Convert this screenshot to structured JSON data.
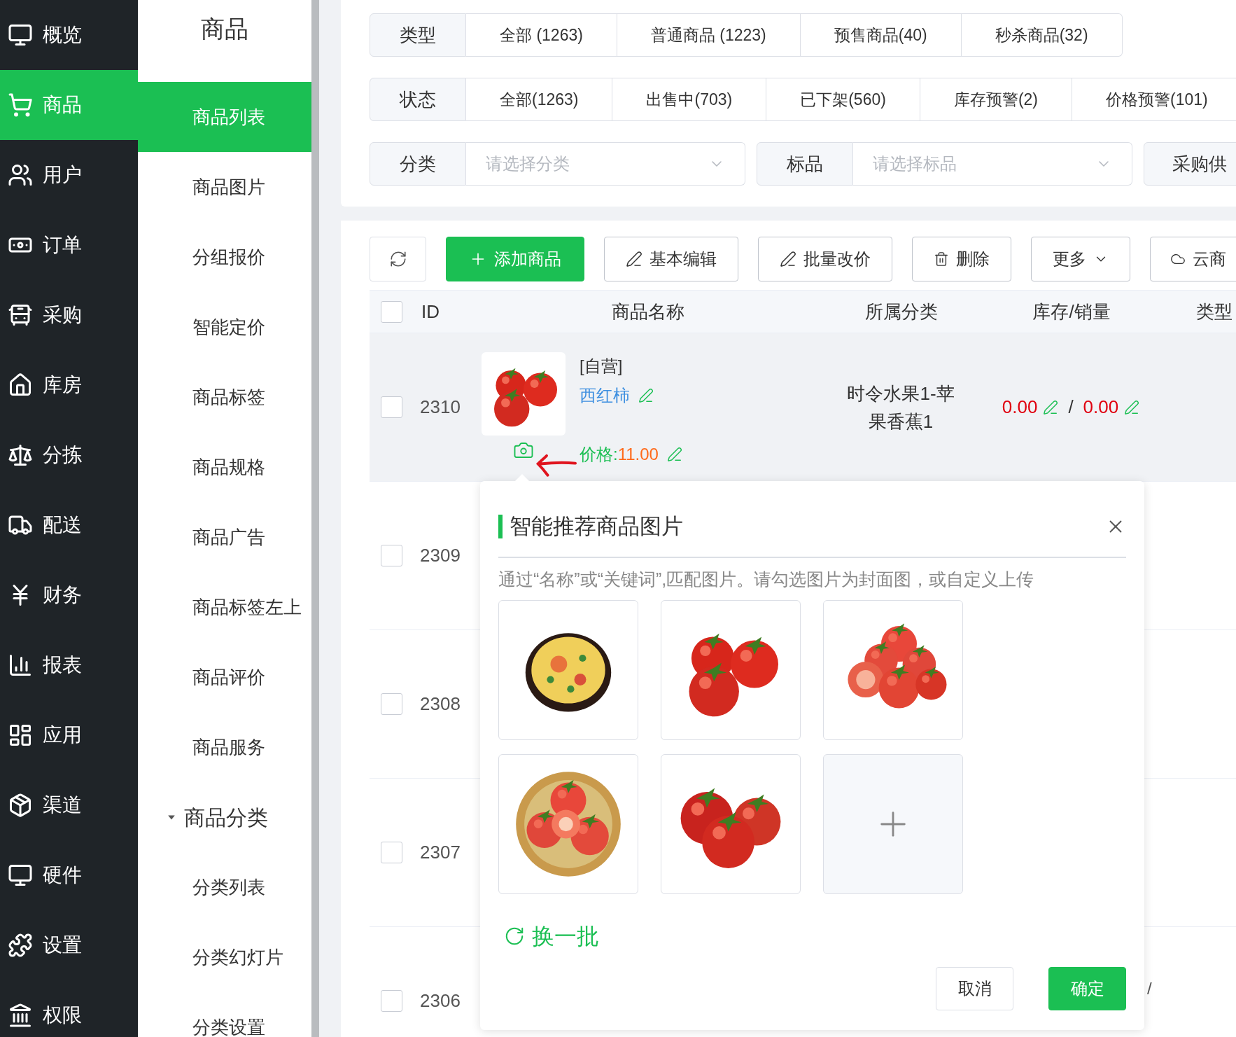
{
  "main_nav": {
    "items": [
      {
        "label": "概览",
        "selected": false
      },
      {
        "label": "商品",
        "selected": true
      },
      {
        "label": "用户",
        "selected": false
      },
      {
        "label": "订单",
        "selected": false
      },
      {
        "label": "采购",
        "selected": false
      },
      {
        "label": "库房",
        "selected": false
      },
      {
        "label": "分拣",
        "selected": false
      },
      {
        "label": "配送",
        "selected": false
      },
      {
        "label": "财务",
        "selected": false
      },
      {
        "label": "报表",
        "selected": false
      },
      {
        "label": "应用",
        "selected": false
      },
      {
        "label": "渠道",
        "selected": false
      },
      {
        "label": "硬件",
        "selected": false
      },
      {
        "label": "设置",
        "selected": false
      },
      {
        "label": "权限",
        "selected": false
      }
    ]
  },
  "sub_nav": {
    "title": "商品",
    "items": [
      {
        "kind": "link",
        "label": "商品列表",
        "selected": true
      },
      {
        "kind": "link",
        "label": "商品图片",
        "selected": false
      },
      {
        "kind": "link",
        "label": "分组报价",
        "selected": false
      },
      {
        "kind": "link",
        "label": "智能定价",
        "selected": false
      },
      {
        "kind": "link",
        "label": "商品标签",
        "selected": false
      },
      {
        "kind": "link",
        "label": "商品规格",
        "selected": false
      },
      {
        "kind": "link",
        "label": "商品广告",
        "selected": false
      },
      {
        "kind": "link",
        "label": "商品标签左上",
        "selected": false
      },
      {
        "kind": "link",
        "label": "商品评价",
        "selected": false
      },
      {
        "kind": "link",
        "label": "商品服务",
        "selected": false
      },
      {
        "kind": "group",
        "label": "商品分类",
        "expanded": true,
        "children": [
          {
            "label": "分类列表",
            "selected": false
          },
          {
            "label": "分类幻灯片",
            "selected": false
          },
          {
            "label": "分类设置",
            "selected": false
          }
        ]
      }
    ]
  },
  "filters": [
    {
      "label": "类型",
      "options": [
        "全部 (1263)",
        "普通商品 (1223)",
        "预售商品(40)",
        "秒杀商品(32)"
      ]
    },
    {
      "label": "状态",
      "options": [
        "全部(1263)",
        "出售中(703)",
        "已下架(560)",
        "库存预警(2)",
        "价格预警(101)"
      ]
    }
  ],
  "selects": [
    {
      "label": "分类",
      "placeholder": "请选择分类"
    },
    {
      "label": "标品",
      "placeholder": "请选择标品"
    },
    {
      "label": "采购供"
    }
  ],
  "toolbar": [
    {
      "kind": "refresh"
    },
    {
      "kind": "primary",
      "label": "添加商品"
    },
    {
      "kind": "edit",
      "label": "基本编辑"
    },
    {
      "kind": "edit",
      "label": "批量改价"
    },
    {
      "kind": "delete",
      "label": "删除"
    },
    {
      "kind": "dropdown",
      "label": "更多"
    },
    {
      "kind": "cloud",
      "label": "云商"
    }
  ],
  "table": {
    "columns": [
      "ID",
      "商品名称",
      "所属分类",
      "库存/销量",
      "类型"
    ],
    "header_checked": false,
    "rows": [
      {
        "id": "2310",
        "checked": false,
        "hovered": true,
        "tag": "[自营]",
        "name": "西红柿",
        "price_label": "价格:",
        "price": "11.00",
        "category": "时令水果1-苹果香蕉1",
        "stock": "0.00",
        "separator": "/",
        "sales": "0.00"
      },
      {
        "id": "2309",
        "checked": false,
        "hovered": false
      },
      {
        "id": "2308",
        "checked": false,
        "hovered": false
      },
      {
        "id": "2307",
        "checked": false,
        "hovered": false
      },
      {
        "id": "2306",
        "checked": false,
        "hovered": false,
        "column_5_fragment": "/"
      }
    ]
  },
  "popover": {
    "title": "智能推荐商品图片",
    "hint": "通过“名称”或“关键词”,匹配图片。请勾选图片为封面图，或自定义上传",
    "images": [
      {
        "kind": "picture"
      },
      {
        "kind": "picture"
      },
      {
        "kind": "picture"
      },
      {
        "kind": "picture"
      },
      {
        "kind": "picture"
      },
      {
        "kind": "upload"
      }
    ],
    "refresh": "换一批",
    "buttons": [
      {
        "kind": "default",
        "label": "取消"
      },
      {
        "kind": "primary",
        "label": "确定"
      }
    ]
  }
}
